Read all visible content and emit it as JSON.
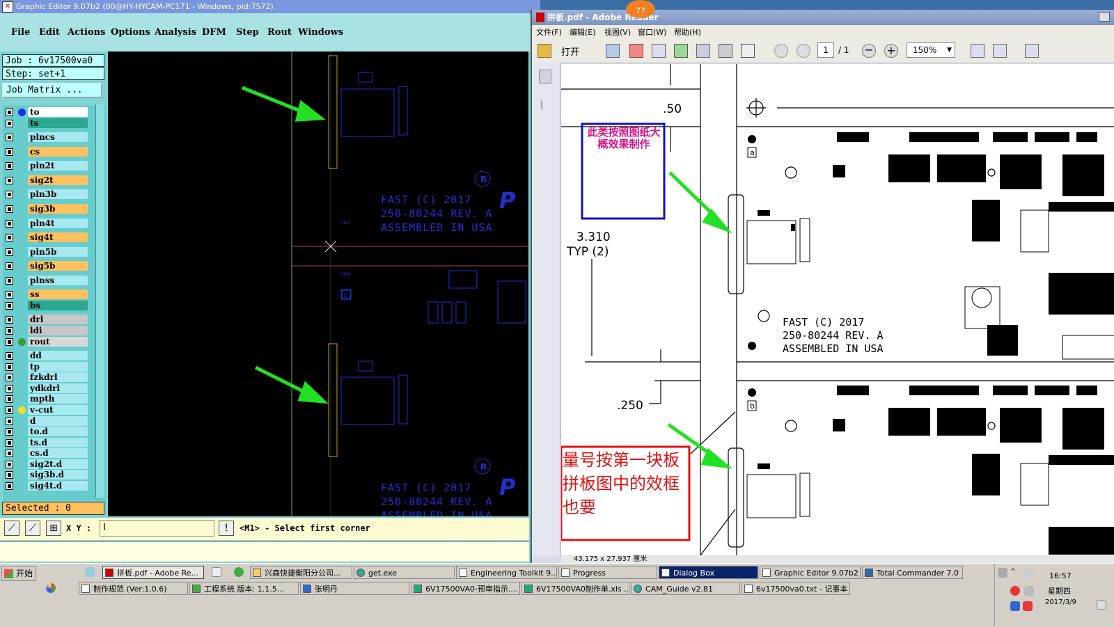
{
  "ge": {
    "title": "Graphic Editor 9.07b2 (00@HY-HYCAM-PC171 - Windows, pid:7572)",
    "menu": [
      "File",
      "Edit",
      "Actions",
      "Options",
      "Analysis",
      "DFM",
      "Step",
      "Rout",
      "Windows"
    ],
    "job": "Job : 6v17500va0",
    "step": "Step: set+1",
    "job_matrix": "Job Matrix ...",
    "layers": [
      {
        "name": "to",
        "color": "#ffffff",
        "dot": "#1030ff"
      },
      {
        "name": "ts",
        "color": "#2aa890",
        "dot": ""
      },
      {
        "name": "plncs",
        "color": "#a8e8f0",
        "dot": ""
      },
      {
        "name": "cs",
        "color": "#ffc060",
        "dot": ""
      },
      {
        "name": "pln2t",
        "color": "#a8e8f0",
        "dot": ""
      },
      {
        "name": "sig2t",
        "color": "#ffc060",
        "dot": ""
      },
      {
        "name": "pln3b",
        "color": "#a8e8f0",
        "dot": ""
      },
      {
        "name": "sig3b",
        "color": "#ffc060",
        "dot": ""
      },
      {
        "name": "pln4t",
        "color": "#a8e8f0",
        "dot": ""
      },
      {
        "name": "sig4t",
        "color": "#ffc060",
        "dot": ""
      },
      {
        "name": "pln5b",
        "color": "#a8e8f0",
        "dot": ""
      },
      {
        "name": "sig5b",
        "color": "#ffc060",
        "dot": ""
      },
      {
        "name": "plnss",
        "color": "#a8e8f0",
        "dot": ""
      },
      {
        "name": "ss",
        "color": "#ffc060",
        "dot": ""
      },
      {
        "name": "bs",
        "color": "#2aa890",
        "dot": ""
      },
      {
        "name": "drl",
        "color": "#c8c8c8",
        "dot": ""
      },
      {
        "name": "ldi",
        "color": "#c8c8c8",
        "dot": ""
      },
      {
        "name": "rout",
        "color": "#d8d8d8",
        "dot": "#30a030"
      },
      {
        "name": "dd",
        "color": "#a8e8f0",
        "dot": ""
      },
      {
        "name": "tp",
        "color": "#a8e8f0",
        "dot": ""
      },
      {
        "name": "fzkdrl",
        "color": "#a8e8f0",
        "dot": ""
      },
      {
        "name": "ydkdrl",
        "color": "#a8e8f0",
        "dot": ""
      },
      {
        "name": "mpth",
        "color": "#a8e8f0",
        "dot": ""
      },
      {
        "name": "v-cut",
        "color": "#a8e8f0",
        "dot": "#f0e020"
      },
      {
        "name": "d",
        "color": "#a8e8f0",
        "dot": ""
      },
      {
        "name": "to.d",
        "color": "#a8e8f0",
        "dot": ""
      },
      {
        "name": "ts.d",
        "color": "#a8e8f0",
        "dot": ""
      },
      {
        "name": "cs.d",
        "color": "#a8e8f0",
        "dot": ""
      },
      {
        "name": "sig2t.d",
        "color": "#a8e8f0",
        "dot": ""
      },
      {
        "name": "sig3b.d",
        "color": "#a8e8f0",
        "dot": ""
      },
      {
        "name": "sig4t.d",
        "color": "#a8e8f0",
        "dot": ""
      }
    ],
    "selected": "Selected : 0",
    "xy_label": "X Y :",
    "xy_value": "I",
    "prompt": "<M1> - Select first corner",
    "canvas_text": {
      "fast": "FAST (C) 2017",
      "rev": "250-80244 REV. A",
      "assembled": "ASSEMBLED IN USA",
      "b_label": "b",
      "fid1": "FID1",
      "fid2": "FID2"
    }
  },
  "ar": {
    "title": "拼板.pdf - Adobe Reader",
    "badge": "77",
    "menu": [
      "文件(F)",
      "编辑(E)",
      "视图(V)",
      "窗口(W)",
      "帮助(H)"
    ],
    "open_label": "打开",
    "page_current": "1",
    "page_total": "/ 1",
    "zoom": "150%",
    "dims": ".50",
    "dim_3310": "3.310",
    "dim_typ": "TYP (2)",
    "dim_250": ".250",
    "note_blue": "此类按照图纸大概效果制作",
    "note_red": "量号按第一块板拼板图中的效框也要",
    "fast": "FAST (C) 2017",
    "rev": "250-80244 REV. A",
    "assembled": "ASSEMBLED IN USA",
    "status": "43.175 x 27.937 厘米",
    "label_a": "a",
    "label_b": "b"
  },
  "taskbar": {
    "start": "开始",
    "row1": [
      "拼板.pdf - Adobe Re...",
      "兴森快捷衡阳分公司...",
      "get.exe",
      "Engineering Toolkit 9....",
      "Progress",
      "Dialog Box",
      "Graphic Editor 9.07b2 ...",
      "Total Commander 7.0 ..."
    ],
    "row2": [
      "制作规范 (Ver:1.0.6)",
      "工程系统  版本: 1.1.5...",
      "张明丹",
      "6V17500VA0-预审指示....",
      "6V17500VA0制作单.xls ...",
      "CAM_Guide v2.81",
      "6v17500va0.txt - 记事本"
    ],
    "time": "16:57",
    "weekday": "星期四",
    "date": "2017/3/9"
  }
}
